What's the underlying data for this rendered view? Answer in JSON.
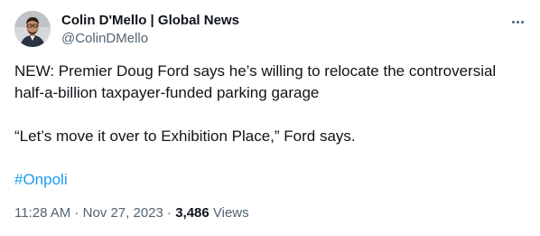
{
  "author": {
    "name": "Colin D'Mello | Global News",
    "handle": "@ColinDMello"
  },
  "tweet": {
    "paragraph_1": "NEW: Premier Doug Ford says he’s willing to relocate the controversial half-a-billion taxpayer-funded parking garage",
    "paragraph_2": "“Let’s move it over to Exhibition Place,” Ford says.",
    "hashtag": "#Onpoli"
  },
  "meta": {
    "time": "11:28 AM",
    "separator": " · ",
    "date": "Nov 27, 2023",
    "views_count": "3,486",
    "views_label": " Views"
  },
  "colors": {
    "text": "#0f1419",
    "secondary": "#536471",
    "link": "#1d9bf0"
  },
  "icons": {
    "more": "more-horizontal-icon"
  }
}
